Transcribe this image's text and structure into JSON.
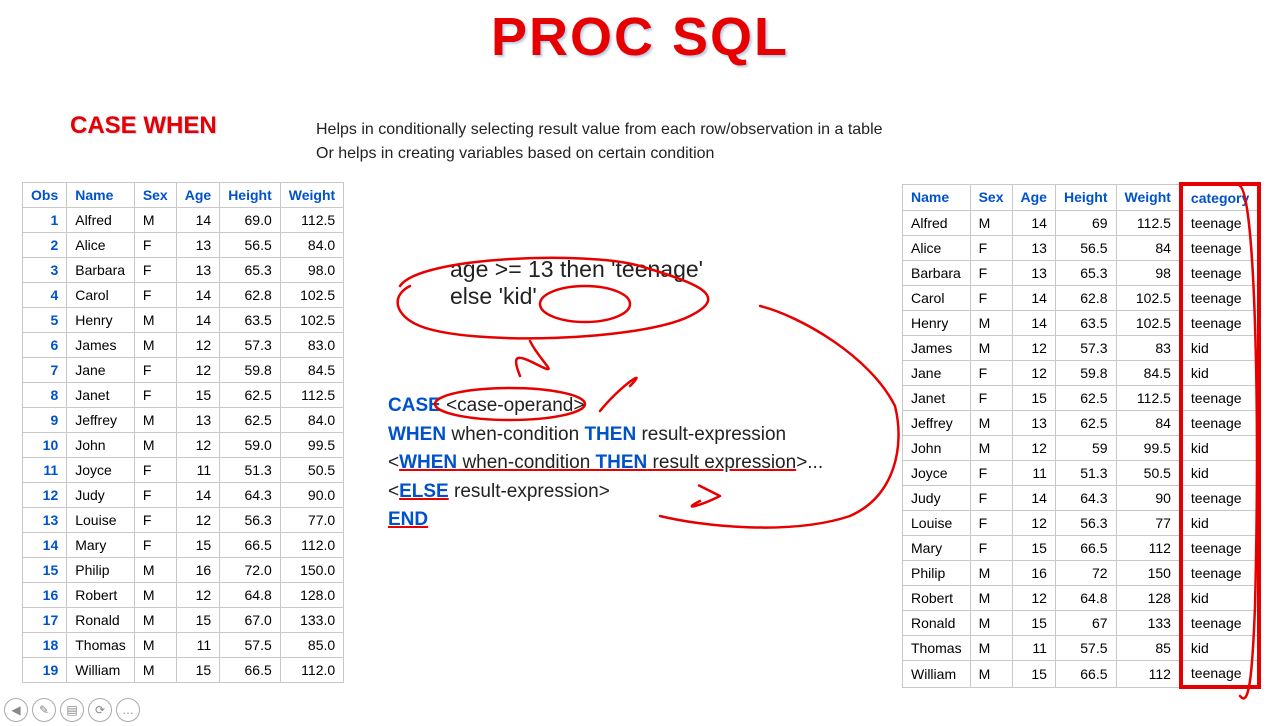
{
  "title": "PROC SQL",
  "subtitle": "CASE WHEN",
  "desc_line1": "Helps in conditionally selecting result value from each row/observation in a table",
  "desc_line2": "Or helps in creating variables based on certain condition",
  "logic": {
    "line1": "age >= 13 then 'teenage'",
    "line2": "else 'kid'"
  },
  "syntax": {
    "case": "CASE",
    "case_op": " <case-operand>",
    "when": "WHEN",
    "then": "THEN",
    "else": "ELSE",
    "end": "END",
    "wc": " when-condition ",
    "re": " result-expression",
    "re2": " result expression",
    "dots": ">...",
    "gt": ">",
    "lt": "<"
  },
  "left_headers": [
    "Obs",
    "Name",
    "Sex",
    "Age",
    "Height",
    "Weight"
  ],
  "right_headers": [
    "Name",
    "Sex",
    "Age",
    "Height",
    "Weight",
    "category"
  ],
  "left_rows": [
    {
      "obs": "1",
      "name": "Alfred",
      "sex": "M",
      "age": "14",
      "height": "69.0",
      "weight": "112.5"
    },
    {
      "obs": "2",
      "name": "Alice",
      "sex": "F",
      "age": "13",
      "height": "56.5",
      "weight": "84.0"
    },
    {
      "obs": "3",
      "name": "Barbara",
      "sex": "F",
      "age": "13",
      "height": "65.3",
      "weight": "98.0"
    },
    {
      "obs": "4",
      "name": "Carol",
      "sex": "F",
      "age": "14",
      "height": "62.8",
      "weight": "102.5"
    },
    {
      "obs": "5",
      "name": "Henry",
      "sex": "M",
      "age": "14",
      "height": "63.5",
      "weight": "102.5"
    },
    {
      "obs": "6",
      "name": "James",
      "sex": "M",
      "age": "12",
      "height": "57.3",
      "weight": "83.0"
    },
    {
      "obs": "7",
      "name": "Jane",
      "sex": "F",
      "age": "12",
      "height": "59.8",
      "weight": "84.5"
    },
    {
      "obs": "8",
      "name": "Janet",
      "sex": "F",
      "age": "15",
      "height": "62.5",
      "weight": "112.5"
    },
    {
      "obs": "9",
      "name": "Jeffrey",
      "sex": "M",
      "age": "13",
      "height": "62.5",
      "weight": "84.0"
    },
    {
      "obs": "10",
      "name": "John",
      "sex": "M",
      "age": "12",
      "height": "59.0",
      "weight": "99.5"
    },
    {
      "obs": "11",
      "name": "Joyce",
      "sex": "F",
      "age": "11",
      "height": "51.3",
      "weight": "50.5"
    },
    {
      "obs": "12",
      "name": "Judy",
      "sex": "F",
      "age": "14",
      "height": "64.3",
      "weight": "90.0"
    },
    {
      "obs": "13",
      "name": "Louise",
      "sex": "F",
      "age": "12",
      "height": "56.3",
      "weight": "77.0"
    },
    {
      "obs": "14",
      "name": "Mary",
      "sex": "F",
      "age": "15",
      "height": "66.5",
      "weight": "112.0"
    },
    {
      "obs": "15",
      "name": "Philip",
      "sex": "M",
      "age": "16",
      "height": "72.0",
      "weight": "150.0"
    },
    {
      "obs": "16",
      "name": "Robert",
      "sex": "M",
      "age": "12",
      "height": "64.8",
      "weight": "128.0"
    },
    {
      "obs": "17",
      "name": "Ronald",
      "sex": "M",
      "age": "15",
      "height": "67.0",
      "weight": "133.0"
    },
    {
      "obs": "18",
      "name": "Thomas",
      "sex": "M",
      "age": "11",
      "height": "57.5",
      "weight": "85.0"
    },
    {
      "obs": "19",
      "name": "William",
      "sex": "M",
      "age": "15",
      "height": "66.5",
      "weight": "112.0"
    }
  ],
  "right_rows": [
    {
      "name": "Alfred",
      "sex": "M",
      "age": "14",
      "height": "69",
      "weight": "112.5",
      "cat": "teenage"
    },
    {
      "name": "Alice",
      "sex": "F",
      "age": "13",
      "height": "56.5",
      "weight": "84",
      "cat": "teenage"
    },
    {
      "name": "Barbara",
      "sex": "F",
      "age": "13",
      "height": "65.3",
      "weight": "98",
      "cat": "teenage"
    },
    {
      "name": "Carol",
      "sex": "F",
      "age": "14",
      "height": "62.8",
      "weight": "102.5",
      "cat": "teenage"
    },
    {
      "name": "Henry",
      "sex": "M",
      "age": "14",
      "height": "63.5",
      "weight": "102.5",
      "cat": "teenage"
    },
    {
      "name": "James",
      "sex": "M",
      "age": "12",
      "height": "57.3",
      "weight": "83",
      "cat": "kid"
    },
    {
      "name": "Jane",
      "sex": "F",
      "age": "12",
      "height": "59.8",
      "weight": "84.5",
      "cat": "kid"
    },
    {
      "name": "Janet",
      "sex": "F",
      "age": "15",
      "height": "62.5",
      "weight": "112.5",
      "cat": "teenage"
    },
    {
      "name": "Jeffrey",
      "sex": "M",
      "age": "13",
      "height": "62.5",
      "weight": "84",
      "cat": "teenage"
    },
    {
      "name": "John",
      "sex": "M",
      "age": "12",
      "height": "59",
      "weight": "99.5",
      "cat": "kid"
    },
    {
      "name": "Joyce",
      "sex": "F",
      "age": "11",
      "height": "51.3",
      "weight": "50.5",
      "cat": "kid"
    },
    {
      "name": "Judy",
      "sex": "F",
      "age": "14",
      "height": "64.3",
      "weight": "90",
      "cat": "teenage"
    },
    {
      "name": "Louise",
      "sex": "F",
      "age": "12",
      "height": "56.3",
      "weight": "77",
      "cat": "kid"
    },
    {
      "name": "Mary",
      "sex": "F",
      "age": "15",
      "height": "66.5",
      "weight": "112",
      "cat": "teenage"
    },
    {
      "name": "Philip",
      "sex": "M",
      "age": "16",
      "height": "72",
      "weight": "150",
      "cat": "teenage"
    },
    {
      "name": "Robert",
      "sex": "M",
      "age": "12",
      "height": "64.8",
      "weight": "128",
      "cat": "kid"
    },
    {
      "name": "Ronald",
      "sex": "M",
      "age": "15",
      "height": "67",
      "weight": "133",
      "cat": "teenage"
    },
    {
      "name": "Thomas",
      "sex": "M",
      "age": "11",
      "height": "57.5",
      "weight": "85",
      "cat": "kid"
    },
    {
      "name": "William",
      "sex": "M",
      "age": "15",
      "height": "66.5",
      "weight": "112",
      "cat": "teenage"
    }
  ],
  "controls": [
    "◀",
    "✎",
    "▤",
    "⟳",
    "…"
  ]
}
